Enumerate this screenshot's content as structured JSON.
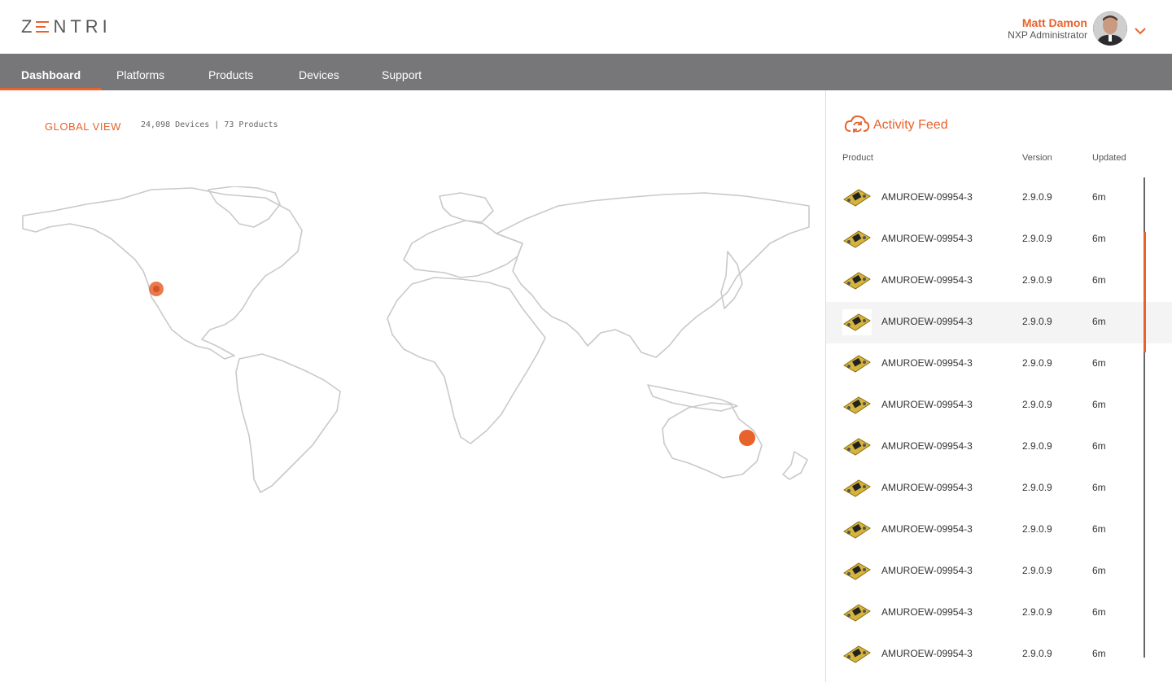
{
  "brand": {
    "logo_text_1": "Z",
    "logo_text_2": "NTRI",
    "accent": "#e8622c"
  },
  "user": {
    "name": "Matt Damon",
    "role": "NXP Administrator",
    "avatar_icon": "avatar-photo",
    "menu_icon": "chevron-down-icon"
  },
  "nav": {
    "items": [
      {
        "label": "Dashboard",
        "active": true
      },
      {
        "label": "Platforms"
      },
      {
        "label": "Products"
      },
      {
        "label": "Devices"
      },
      {
        "label": "Support"
      }
    ]
  },
  "global_view": {
    "title": "GLOBAL VIEW",
    "stats": "24,098 Devices | 73 Products",
    "map_markers": [
      "west-coast-usa",
      "southeast-australia"
    ]
  },
  "feed": {
    "title": "Activity Feed",
    "icon": "cloud-sync-icon",
    "columns": {
      "product": "Product",
      "version": "Version",
      "updated": "Updated"
    },
    "rows": [
      {
        "product": "AMUROEW-09954-3",
        "version": "2.9.0.9",
        "updated": "6m"
      },
      {
        "product": "AMUROEW-09954-3",
        "version": "2.9.0.9",
        "updated": "6m"
      },
      {
        "product": "AMUROEW-09954-3",
        "version": "2.9.0.9",
        "updated": "6m"
      },
      {
        "product": "AMUROEW-09954-3",
        "version": "2.9.0.9",
        "updated": "6m"
      },
      {
        "product": "AMUROEW-09954-3",
        "version": "2.9.0.9",
        "updated": "6m"
      },
      {
        "product": "AMUROEW-09954-3",
        "version": "2.9.0.9",
        "updated": "6m"
      },
      {
        "product": "AMUROEW-09954-3",
        "version": "2.9.0.9",
        "updated": "6m"
      },
      {
        "product": "AMUROEW-09954-3",
        "version": "2.9.0.9",
        "updated": "6m"
      },
      {
        "product": "AMUROEW-09954-3",
        "version": "2.9.0.9",
        "updated": "6m"
      },
      {
        "product": "AMUROEW-09954-3",
        "version": "2.9.0.9",
        "updated": "6m"
      },
      {
        "product": "AMUROEW-09954-3",
        "version": "2.9.0.9",
        "updated": "6m"
      },
      {
        "product": "AMUROEW-09954-3",
        "version": "2.9.0.9",
        "updated": "6m"
      }
    ]
  }
}
